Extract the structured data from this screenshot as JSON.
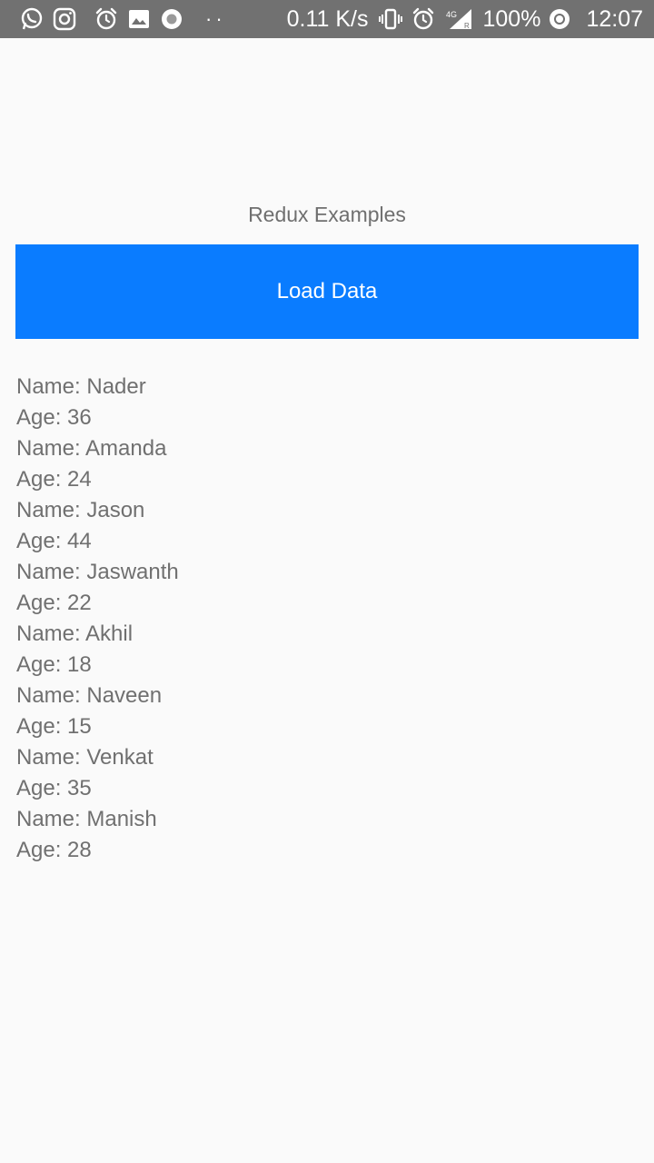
{
  "status_bar": {
    "icons_left": [
      "whatsapp-icon",
      "instagram-icon",
      "alarm-icon",
      "gallery-icon",
      "record-icon"
    ],
    "dots": "··",
    "net_speed": "0.11 K/s",
    "icons_right": [
      "vibrate-icon",
      "alarm-icon",
      "signal-4g-icon"
    ],
    "battery": "100%",
    "time": "12:07",
    "colors": {
      "background": "#717171",
      "foreground": "#ffffff"
    }
  },
  "app": {
    "title": "Redux Examples",
    "load_button_label": "Load Data",
    "colors": {
      "button": "#0a7cff",
      "text": "#707070",
      "background": "#fafafa"
    }
  },
  "people": [
    {
      "name": "Name: Nader",
      "age": "Age: 36"
    },
    {
      "name": "Name: Amanda",
      "age": "Age: 24"
    },
    {
      "name": "Name: Jason",
      "age": "Age: 44"
    },
    {
      "name": "Name: Jaswanth",
      "age": "Age: 22"
    },
    {
      "name": "Name: Akhil",
      "age": "Age: 18"
    },
    {
      "name": "Name: Naveen",
      "age": "Age: 15"
    },
    {
      "name": "Name: Venkat",
      "age": "Age: 35"
    },
    {
      "name": "Name: Manish",
      "age": "Age: 28"
    }
  ]
}
